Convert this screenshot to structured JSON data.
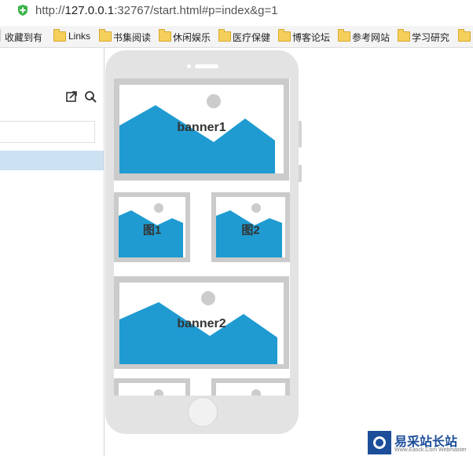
{
  "address_bar": {
    "url_scheme": "http://",
    "url_host": "127.0.0.1",
    "url_rest": ":32767/start.html#p=index&g=1",
    "icon": "shield-icon"
  },
  "bookmarks": {
    "favorites_label": "收藏到有",
    "items": [
      "Links",
      "书集阅读",
      "休闲娱乐",
      "医疗保健",
      "博客论坛",
      "参考网站",
      "学习研究"
    ]
  },
  "left_panel": {
    "icons": [
      "export-icon",
      "pin-icon"
    ]
  },
  "phone": {
    "blocks": {
      "banner1": "banner1",
      "img1": "图1",
      "img2": "图2",
      "banner2": "banner2"
    }
  },
  "watermark": {
    "name": "易采站长站",
    "sub": "Www.Easck.Com  Webmaster"
  },
  "colors": {
    "mountain": "#1f9bd1",
    "frame": "#cbcbcb",
    "sun": "#cccccc",
    "phone_body": "#e3e3e3",
    "selection": "#cce1f2"
  }
}
